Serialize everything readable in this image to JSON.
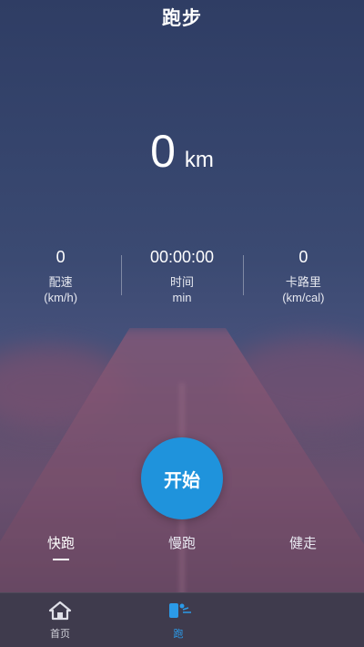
{
  "title": "跑步",
  "distance": {
    "value": "0",
    "unit": "km"
  },
  "stats": [
    {
      "value": "0",
      "label": "配速",
      "unit": "(km/h)"
    },
    {
      "value": "00:00:00",
      "label": "时间",
      "unit": "min"
    },
    {
      "value": "0",
      "label": "卡路里",
      "unit": "(km/cal)"
    }
  ],
  "start_button": "开始",
  "modes": [
    {
      "label": "快跑",
      "active": true
    },
    {
      "label": "慢跑",
      "active": false
    },
    {
      "label": "健走",
      "active": false
    }
  ],
  "bottom_nav": [
    {
      "label": "首页",
      "icon": "home-icon",
      "active": false
    },
    {
      "label": "跑",
      "icon": "run-icon",
      "active": true
    }
  ],
  "colors": {
    "accent": "#1f93dc",
    "nav_active": "#2b9ae8"
  }
}
